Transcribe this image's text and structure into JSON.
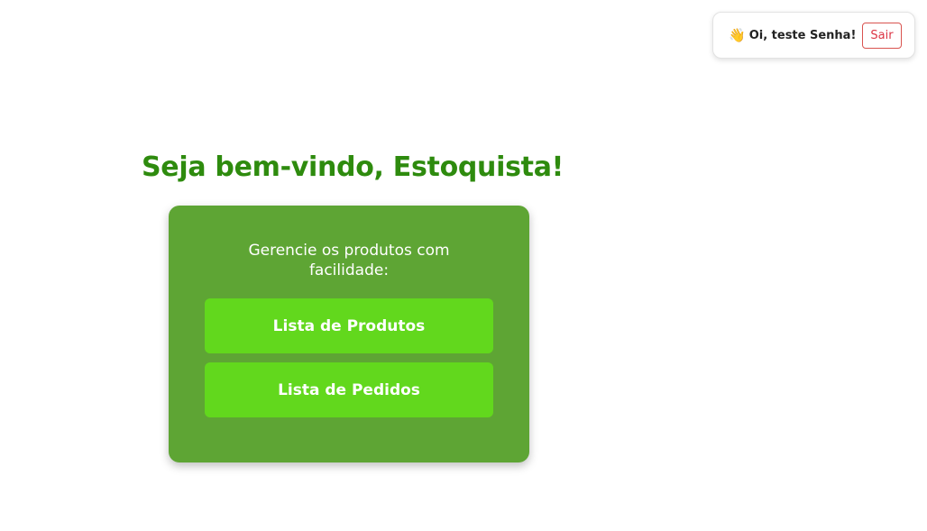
{
  "header": {
    "wave_icon": "👋",
    "greeting": "Oi, teste Senha!",
    "logout_label": "Sair"
  },
  "main": {
    "title": "Seja bem-vindo, Estoquista!",
    "card": {
      "text": "Gerencie os produtos com facilidade:",
      "buttons": [
        {
          "label": "Lista de Produtos"
        },
        {
          "label": "Lista de Pedidos"
        }
      ]
    }
  },
  "colors": {
    "title": "#2e8b0e",
    "card_bg": "#5ea534",
    "button_bg": "#62d81d",
    "logout": "#dc3545"
  }
}
